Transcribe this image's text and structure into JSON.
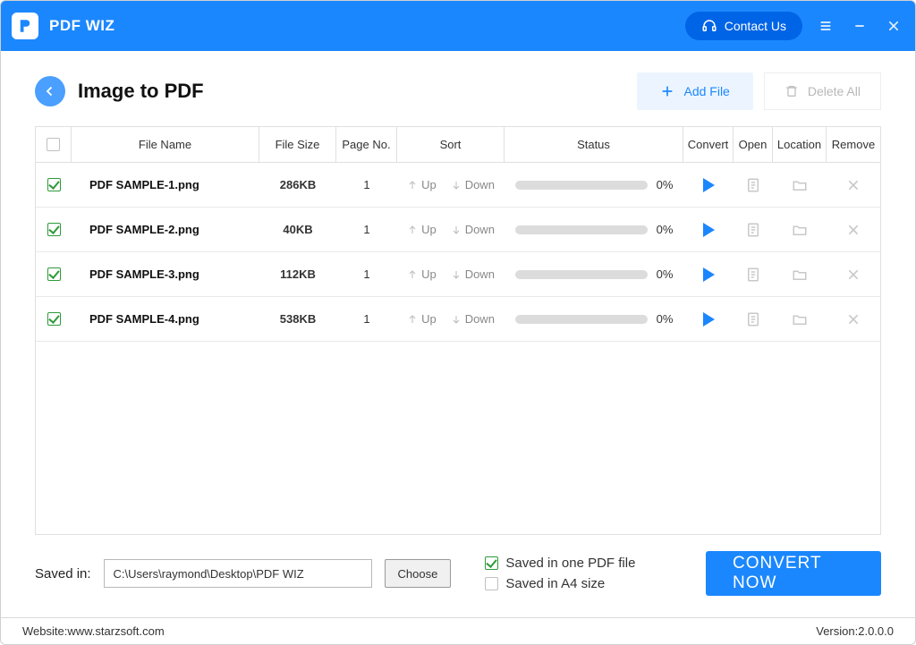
{
  "app": {
    "title": "PDF WIZ"
  },
  "titlebar": {
    "contact": "Contact Us"
  },
  "page": {
    "title": "Image to PDF",
    "add_file": "Add File",
    "delete_all": "Delete All"
  },
  "columns": {
    "file_name": "File Name",
    "file_size": "File Size",
    "page_no": "Page No.",
    "sort": "Sort",
    "status": "Status",
    "convert": "Convert",
    "open": "Open",
    "location": "Location",
    "remove": "Remove"
  },
  "sort": {
    "up": "Up",
    "down": "Down"
  },
  "files": [
    {
      "checked": true,
      "name": "PDF SAMPLE-1.png",
      "size": "286KB",
      "pages": "1",
      "pct": "0%"
    },
    {
      "checked": true,
      "name": "PDF SAMPLE-2.png",
      "size": "40KB",
      "pages": "1",
      "pct": "0%"
    },
    {
      "checked": true,
      "name": "PDF SAMPLE-3.png",
      "size": "112KB",
      "pages": "1",
      "pct": "0%"
    },
    {
      "checked": true,
      "name": "PDF SAMPLE-4.png",
      "size": "538KB",
      "pages": "1",
      "pct": "0%"
    }
  ],
  "bottom": {
    "saved_in": "Saved in:",
    "path": "C:\\Users\\raymond\\Desktop\\PDF WIZ",
    "choose": "Choose",
    "opt_one_file": "Saved in one PDF file",
    "opt_a4": "Saved in A4 size",
    "convert_now": "CONVERT NOW"
  },
  "status": {
    "website_label": "Website: ",
    "website": "www.starzsoft.com",
    "version_label": "Version: ",
    "version": "2.0.0.0"
  }
}
